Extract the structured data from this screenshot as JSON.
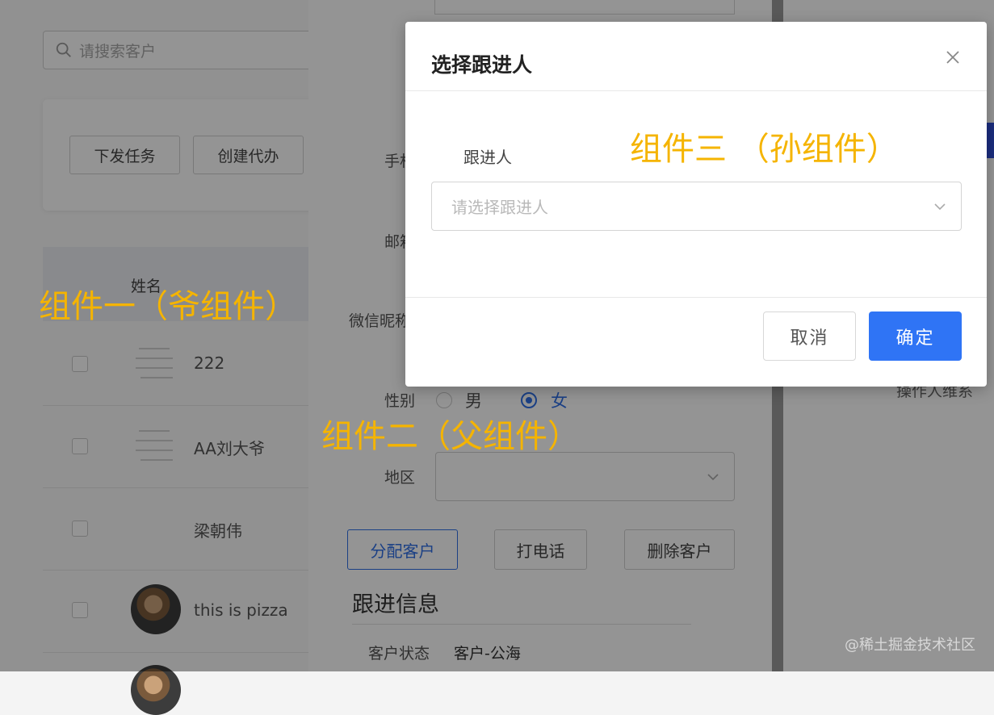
{
  "colors": {
    "primary": "#2f74f5",
    "annotation": "#f5b400",
    "mask": "rgba(0,0,0,0.42)"
  },
  "list_page": {
    "search_placeholder": "请搜索客户",
    "actions": {
      "dispatch_task": "下发任务",
      "create_todo": "创建代办"
    },
    "column_name": "姓名",
    "rows": [
      {
        "name": "222"
      },
      {
        "name": "AA刘大爷"
      },
      {
        "name": "梁朝伟"
      },
      {
        "name": "this is pizza"
      }
    ]
  },
  "detail_drawer": {
    "labels": {
      "phone": "手机",
      "email": "邮箱",
      "wechat": "微信昵称",
      "gender": "性别",
      "region": "地区"
    },
    "gender_options": {
      "male": "男",
      "female": "女"
    },
    "gender_selected": "女",
    "buttons": {
      "assign": "分配客户",
      "call": "打电话",
      "delete": "删除客户"
    },
    "section_title": "跟进信息",
    "status_label": "客户状态",
    "status_value": "客户-公海"
  },
  "right_panel": {
    "text": "操作人维系"
  },
  "modal": {
    "title": "选择跟进人",
    "follow_label": "跟进人",
    "follow_placeholder": "请选择跟进人",
    "cancel": "取消",
    "ok": "确定"
  },
  "annotations": {
    "grandparent": "组件一（爷组件）",
    "parent": "组件二（父组件）",
    "grandchild": "组件三 （孙组件）"
  },
  "watermark": "@稀土掘金技术社区"
}
